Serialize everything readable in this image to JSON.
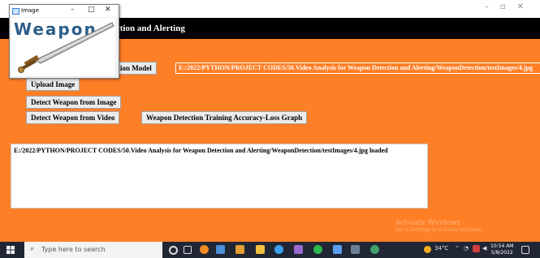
{
  "window": {
    "controls": [
      "–",
      "▫",
      "✕"
    ]
  },
  "header": {
    "title": "ection and Alerting"
  },
  "buttons": {
    "load_model": "ction Model",
    "upload": "Upload Image",
    "detect_image": "Detect Weapon from Image",
    "detect_video": "Detect Weapon from Video",
    "graph": "Weapon Detection Training Accuracy-Loss Graph"
  },
  "path_label": "E:/2022/PYTHON/PROJECT CODES/50.Video Analysis for Weapon Detection and Alerting/WeaponDetection/testImages/4.jpg",
  "output": {
    "text": "E:/2022/PYTHON/PROJECT CODES/50.Video Analysis for Weapon Detection and Alerting/WeaponDetection/testImages/4.jpg loaded"
  },
  "watermark": {
    "line1": "Activate Windows",
    "line2": "Go to Settings to activate Windows."
  },
  "popup": {
    "title": "Image",
    "image_text": "Weapon",
    "controls": [
      "–",
      "□",
      "✕"
    ]
  },
  "taskbar": {
    "search_placeholder": "Type here to search",
    "temperature": "34°C",
    "time": "10:54 AM",
    "date": "5/8/2022",
    "colors": {
      "bar": "#202634",
      "accent": "#ff7f27"
    }
  }
}
